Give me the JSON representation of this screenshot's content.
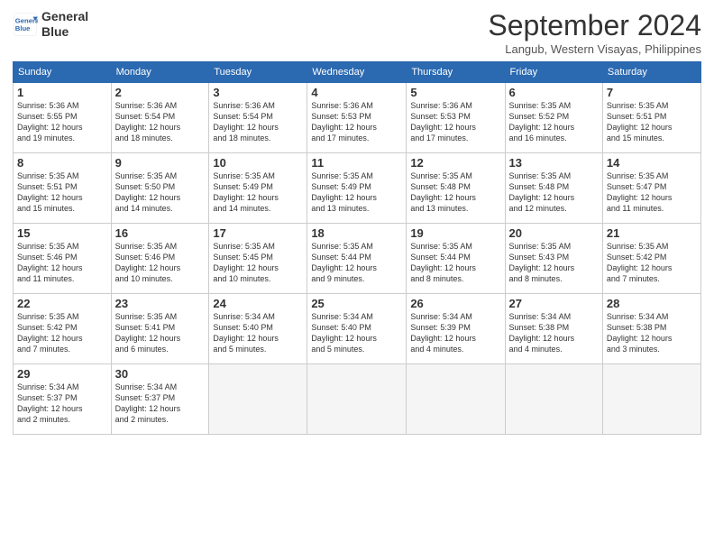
{
  "header": {
    "logo_line1": "General",
    "logo_line2": "Blue",
    "month": "September 2024",
    "location": "Langub, Western Visayas, Philippines"
  },
  "weekdays": [
    "Sunday",
    "Monday",
    "Tuesday",
    "Wednesday",
    "Thursday",
    "Friday",
    "Saturday"
  ],
  "weeks": [
    [
      {
        "day": "1",
        "sunrise": "5:36 AM",
        "sunset": "5:55 PM",
        "daylight": "12 hours and 19 minutes."
      },
      {
        "day": "2",
        "sunrise": "5:36 AM",
        "sunset": "5:54 PM",
        "daylight": "12 hours and 18 minutes."
      },
      {
        "day": "3",
        "sunrise": "5:36 AM",
        "sunset": "5:54 PM",
        "daylight": "12 hours and 18 minutes."
      },
      {
        "day": "4",
        "sunrise": "5:36 AM",
        "sunset": "5:53 PM",
        "daylight": "12 hours and 17 minutes."
      },
      {
        "day": "5",
        "sunrise": "5:36 AM",
        "sunset": "5:53 PM",
        "daylight": "12 hours and 17 minutes."
      },
      {
        "day": "6",
        "sunrise": "5:35 AM",
        "sunset": "5:52 PM",
        "daylight": "12 hours and 16 minutes."
      },
      {
        "day": "7",
        "sunrise": "5:35 AM",
        "sunset": "5:51 PM",
        "daylight": "12 hours and 15 minutes."
      }
    ],
    [
      {
        "day": "8",
        "sunrise": "5:35 AM",
        "sunset": "5:51 PM",
        "daylight": "12 hours and 15 minutes."
      },
      {
        "day": "9",
        "sunrise": "5:35 AM",
        "sunset": "5:50 PM",
        "daylight": "12 hours and 14 minutes."
      },
      {
        "day": "10",
        "sunrise": "5:35 AM",
        "sunset": "5:49 PM",
        "daylight": "12 hours and 14 minutes."
      },
      {
        "day": "11",
        "sunrise": "5:35 AM",
        "sunset": "5:49 PM",
        "daylight": "12 hours and 13 minutes."
      },
      {
        "day": "12",
        "sunrise": "5:35 AM",
        "sunset": "5:48 PM",
        "daylight": "12 hours and 13 minutes."
      },
      {
        "day": "13",
        "sunrise": "5:35 AM",
        "sunset": "5:48 PM",
        "daylight": "12 hours and 12 minutes."
      },
      {
        "day": "14",
        "sunrise": "5:35 AM",
        "sunset": "5:47 PM",
        "daylight": "12 hours and 11 minutes."
      }
    ],
    [
      {
        "day": "15",
        "sunrise": "5:35 AM",
        "sunset": "5:46 PM",
        "daylight": "12 hours and 11 minutes."
      },
      {
        "day": "16",
        "sunrise": "5:35 AM",
        "sunset": "5:46 PM",
        "daylight": "12 hours and 10 minutes."
      },
      {
        "day": "17",
        "sunrise": "5:35 AM",
        "sunset": "5:45 PM",
        "daylight": "12 hours and 10 minutes."
      },
      {
        "day": "18",
        "sunrise": "5:35 AM",
        "sunset": "5:44 PM",
        "daylight": "12 hours and 9 minutes."
      },
      {
        "day": "19",
        "sunrise": "5:35 AM",
        "sunset": "5:44 PM",
        "daylight": "12 hours and 8 minutes."
      },
      {
        "day": "20",
        "sunrise": "5:35 AM",
        "sunset": "5:43 PM",
        "daylight": "12 hours and 8 minutes."
      },
      {
        "day": "21",
        "sunrise": "5:35 AM",
        "sunset": "5:42 PM",
        "daylight": "12 hours and 7 minutes."
      }
    ],
    [
      {
        "day": "22",
        "sunrise": "5:35 AM",
        "sunset": "5:42 PM",
        "daylight": "12 hours and 7 minutes."
      },
      {
        "day": "23",
        "sunrise": "5:35 AM",
        "sunset": "5:41 PM",
        "daylight": "12 hours and 6 minutes."
      },
      {
        "day": "24",
        "sunrise": "5:34 AM",
        "sunset": "5:40 PM",
        "daylight": "12 hours and 5 minutes."
      },
      {
        "day": "25",
        "sunrise": "5:34 AM",
        "sunset": "5:40 PM",
        "daylight": "12 hours and 5 minutes."
      },
      {
        "day": "26",
        "sunrise": "5:34 AM",
        "sunset": "5:39 PM",
        "daylight": "12 hours and 4 minutes."
      },
      {
        "day": "27",
        "sunrise": "5:34 AM",
        "sunset": "5:38 PM",
        "daylight": "12 hours and 4 minutes."
      },
      {
        "day": "28",
        "sunrise": "5:34 AM",
        "sunset": "5:38 PM",
        "daylight": "12 hours and 3 minutes."
      }
    ],
    [
      {
        "day": "29",
        "sunrise": "5:34 AM",
        "sunset": "5:37 PM",
        "daylight": "12 hours and 2 minutes."
      },
      {
        "day": "30",
        "sunrise": "5:34 AM",
        "sunset": "5:37 PM",
        "daylight": "12 hours and 2 minutes."
      },
      null,
      null,
      null,
      null,
      null
    ]
  ]
}
